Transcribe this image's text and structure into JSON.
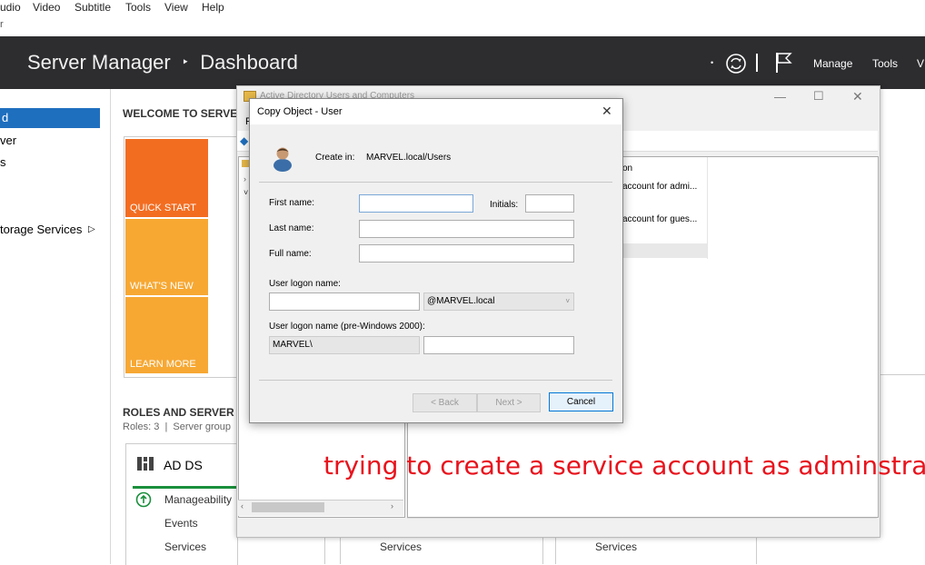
{
  "menubar": {
    "items": [
      "udio",
      "Video",
      "Subtitle",
      "Tools",
      "View",
      "Help"
    ],
    "subbar_text": "r"
  },
  "header": {
    "app": "Server Manager",
    "separator": "‣",
    "page": "Dashboard",
    "manage": "Manage",
    "tools": "Tools",
    "view": "V"
  },
  "sidebar": {
    "items": [
      {
        "label": "d",
        "active": true
      },
      {
        "label": "ver",
        "active": false
      },
      {
        "label": "s",
        "active": false
      },
      {
        "label": "torage Services",
        "active": false
      }
    ]
  },
  "main": {
    "welcome": "WELCOME TO SERVE",
    "tiles": [
      {
        "label": "QUICK START",
        "color": "#f36d21"
      },
      {
        "label": "WHAT'S NEW",
        "color": "#f7a833"
      },
      {
        "label": "LEARN MORE",
        "color": "#f7a833"
      }
    ],
    "roles_title": "ROLES AND SERVER",
    "roles_sub": "Roles: 3  |  Server group",
    "adds": "AD DS",
    "manageability": "Manageability",
    "events": "Events",
    "services": [
      "Services",
      "Services",
      "Services"
    ]
  },
  "aduc": {
    "title": "Active Directory Users and Computers",
    "menu_letter": "F",
    "col_header": "on",
    "rows": [
      "account for admi...",
      "account for gues..."
    ]
  },
  "dialog": {
    "title": "Copy Object - User",
    "create_in_label": "Create in:",
    "create_in_value": "MARVEL.local/Users",
    "first_name_label": "First name:",
    "first_name_value": "",
    "initials_label": "Initials:",
    "initials_value": "",
    "last_name_label": "Last name:",
    "last_name_value": "",
    "full_name_label": "Full name:",
    "full_name_value": "",
    "logon_label": "User logon name:",
    "logon_value": "",
    "domain_value": "@MARVEL.local",
    "pre2000_label": "User logon name (pre-Windows 2000):",
    "pre2000_domain": "MARVEL\\",
    "pre2000_value": "",
    "back": "< Back",
    "next": "Next >",
    "cancel": "Cancel"
  },
  "overlay_text": "trying to create a service account as adminstraotr",
  "colors": {
    "header_bg": "#2d2d30",
    "active_blue": "#1f6fbf",
    "overlay_red": "#e8121c",
    "green_icon": "#1a8f3c"
  }
}
